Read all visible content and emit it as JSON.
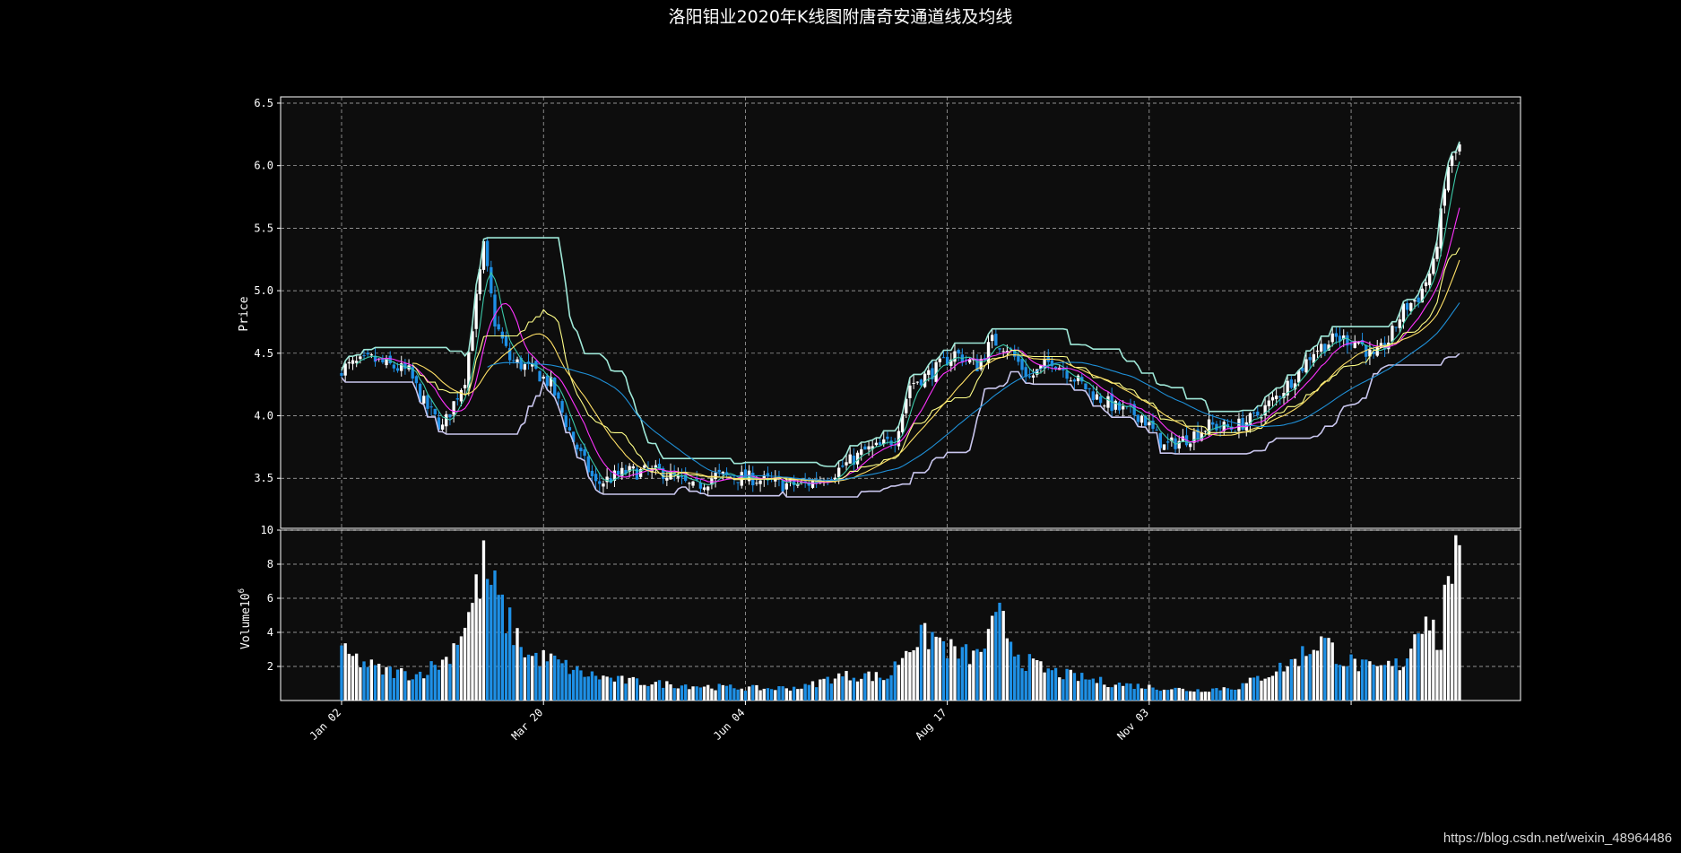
{
  "chart_data": [
    {
      "type": "candlestick",
      "panel": "price",
      "title": "洛阳钼业2020年K线图附唐奇安通道线及均线",
      "ylabel": "Price",
      "ylim": [
        3.1,
        6.55
      ],
      "yticks": [
        3.5,
        4.0,
        4.5,
        5.0,
        5.5,
        6.0,
        6.5
      ],
      "xtick_labels": [
        "Jan 02",
        "Mar 20",
        "Jun 04",
        "Aug 17",
        "Nov 03"
      ],
      "grid": true,
      "background": "#0d0d0d",
      "up_color": "#ffffff",
      "down_color": "#1e90e6",
      "anchors": [
        {
          "x": 0,
          "v": 4.38
        },
        {
          "x": 8,
          "v": 4.45
        },
        {
          "x": 18,
          "v": 4.35
        },
        {
          "x": 22,
          "v": 4.1
        },
        {
          "x": 27,
          "v": 3.9
        },
        {
          "x": 33,
          "v": 4.3
        },
        {
          "x": 38,
          "v": 5.35
        },
        {
          "x": 41,
          "v": 4.75
        },
        {
          "x": 45,
          "v": 4.45
        },
        {
          "x": 52,
          "v": 4.35
        },
        {
          "x": 56,
          "v": 4.25
        },
        {
          "x": 62,
          "v": 3.8
        },
        {
          "x": 68,
          "v": 3.45
        },
        {
          "x": 76,
          "v": 3.55
        },
        {
          "x": 86,
          "v": 3.55
        },
        {
          "x": 94,
          "v": 3.42
        },
        {
          "x": 100,
          "v": 3.52
        },
        {
          "x": 110,
          "v": 3.5
        },
        {
          "x": 118,
          "v": 3.45
        },
        {
          "x": 124,
          "v": 3.45
        },
        {
          "x": 132,
          "v": 3.55
        },
        {
          "x": 140,
          "v": 3.72
        },
        {
          "x": 144,
          "v": 3.75
        },
        {
          "x": 148,
          "v": 3.82
        },
        {
          "x": 152,
          "v": 4.25
        },
        {
          "x": 158,
          "v": 4.35
        },
        {
          "x": 164,
          "v": 4.5
        },
        {
          "x": 170,
          "v": 4.4
        },
        {
          "x": 174,
          "v": 4.6
        },
        {
          "x": 178,
          "v": 4.55
        },
        {
          "x": 184,
          "v": 4.3
        },
        {
          "x": 190,
          "v": 4.45
        },
        {
          "x": 196,
          "v": 4.3
        },
        {
          "x": 202,
          "v": 4.15
        },
        {
          "x": 208,
          "v": 4.05
        },
        {
          "x": 214,
          "v": 4.0
        },
        {
          "x": 220,
          "v": 3.75
        },
        {
          "x": 226,
          "v": 3.82
        },
        {
          "x": 232,
          "v": 3.92
        },
        {
          "x": 238,
          "v": 3.9
        },
        {
          "x": 244,
          "v": 3.98
        },
        {
          "x": 250,
          "v": 4.15
        },
        {
          "x": 256,
          "v": 4.35
        },
        {
          "x": 260,
          "v": 4.52
        },
        {
          "x": 266,
          "v": 4.62
        },
        {
          "x": 272,
          "v": 4.6
        },
        {
          "x": 276,
          "v": 4.45
        },
        {
          "x": 280,
          "v": 4.6
        },
        {
          "x": 284,
          "v": 4.85
        },
        {
          "x": 288,
          "v": 4.95
        },
        {
          "x": 292,
          "v": 5.2
        },
        {
          "x": 296,
          "v": 6.0
        },
        {
          "x": 299,
          "v": 6.15
        }
      ],
      "series": [
        {
          "name": "",
          "kind": "donchian_upper",
          "window": 20,
          "color": "#9fe8d8"
        },
        {
          "name": "",
          "kind": "donchian_lower",
          "window": 20,
          "color": "#c9c6ee"
        },
        {
          "name": "",
          "kind": "ma",
          "window": 5,
          "color": "#3cc8a8"
        },
        {
          "name": "",
          "kind": "ma",
          "window": 10,
          "color": "#ff33ff"
        },
        {
          "name": "",
          "kind": "donchian_mid",
          "window": 20,
          "color": "#ffff88"
        },
        {
          "name": "",
          "kind": "ma",
          "window": 20,
          "color": "#ffe066"
        },
        {
          "name": "",
          "kind": "ma",
          "window": 40,
          "color": "#1f8fd6"
        }
      ]
    },
    {
      "type": "bar",
      "panel": "volume",
      "ylabel": "Volume",
      "ylabel_exp": "6",
      "ylim": [
        0,
        10
      ],
      "yticks": [
        2,
        4,
        6,
        8,
        10
      ],
      "volume_anchors": [
        {
          "x": 0,
          "v": 2.8
        },
        {
          "x": 10,
          "v": 1.8
        },
        {
          "x": 20,
          "v": 1.5
        },
        {
          "x": 28,
          "v": 2.4
        },
        {
          "x": 34,
          "v": 5.0
        },
        {
          "x": 38,
          "v": 7.8
        },
        {
          "x": 44,
          "v": 4.8
        },
        {
          "x": 50,
          "v": 2.6
        },
        {
          "x": 56,
          "v": 2.4
        },
        {
          "x": 64,
          "v": 1.6
        },
        {
          "x": 74,
          "v": 1.2
        },
        {
          "x": 84,
          "v": 1.0
        },
        {
          "x": 100,
          "v": 0.8
        },
        {
          "x": 114,
          "v": 0.7
        },
        {
          "x": 124,
          "v": 0.8
        },
        {
          "x": 132,
          "v": 1.4
        },
        {
          "x": 140,
          "v": 1.5
        },
        {
          "x": 146,
          "v": 1.3
        },
        {
          "x": 152,
          "v": 3.4
        },
        {
          "x": 158,
          "v": 3.8
        },
        {
          "x": 164,
          "v": 2.8
        },
        {
          "x": 170,
          "v": 2.6
        },
        {
          "x": 176,
          "v": 4.8
        },
        {
          "x": 182,
          "v": 2.4
        },
        {
          "x": 188,
          "v": 1.8
        },
        {
          "x": 196,
          "v": 1.4
        },
        {
          "x": 206,
          "v": 1.0
        },
        {
          "x": 216,
          "v": 0.8
        },
        {
          "x": 228,
          "v": 0.6
        },
        {
          "x": 240,
          "v": 0.8
        },
        {
          "x": 246,
          "v": 1.4
        },
        {
          "x": 254,
          "v": 2.2
        },
        {
          "x": 262,
          "v": 3.6
        },
        {
          "x": 268,
          "v": 2.4
        },
        {
          "x": 276,
          "v": 1.8
        },
        {
          "x": 284,
          "v": 2.2
        },
        {
          "x": 290,
          "v": 5.5
        },
        {
          "x": 294,
          "v": 3.0
        },
        {
          "x": 296,
          "v": 8.5
        },
        {
          "x": 299,
          "v": 7.6
        }
      ],
      "up_color": "#ffffff",
      "down_color": "#1e90e6"
    }
  ],
  "watermark": "https://blog.csdn.net/weixin_48964486"
}
